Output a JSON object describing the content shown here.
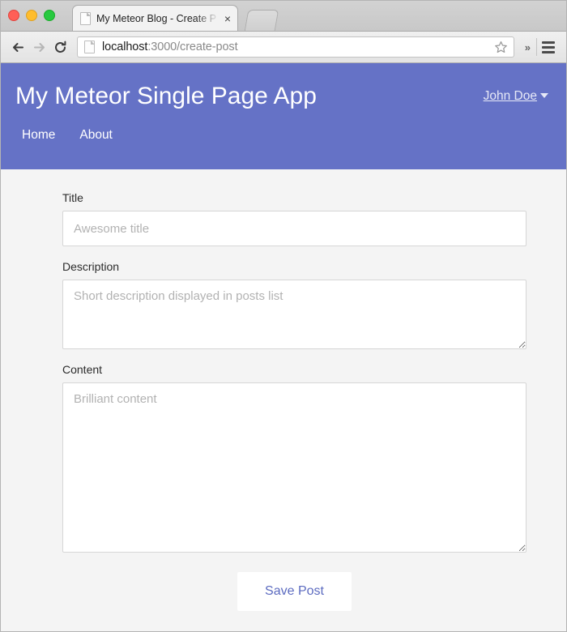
{
  "browser": {
    "tab": {
      "title": "My Meteor Blog - Create P",
      "close_label": "×",
      "favicon": "page-icon"
    },
    "new_tab_label": "",
    "toolbar": {
      "back_label": "←",
      "forward_label": "→",
      "reload_label": "↻",
      "url_host": "localhost",
      "url_path": ":3000/create-post",
      "url_full": "localhost:3000/create-post",
      "bookmark_label": "☆",
      "overflow_label": "»",
      "menu_label": "≡"
    }
  },
  "site": {
    "title": "My Meteor Single Page App",
    "user_menu": "John Doe",
    "nav": [
      {
        "label": "Home"
      },
      {
        "label": "About"
      }
    ],
    "accent_color": "#6572c6",
    "link_color": "#5c6bc0"
  },
  "form": {
    "title": {
      "label": "Title",
      "placeholder": "Awesome title",
      "value": ""
    },
    "description": {
      "label": "Description",
      "placeholder": "Short description displayed in posts list",
      "value": ""
    },
    "content": {
      "label": "Content",
      "placeholder": "Brilliant content",
      "value": ""
    },
    "submit_label": "Save Post"
  }
}
